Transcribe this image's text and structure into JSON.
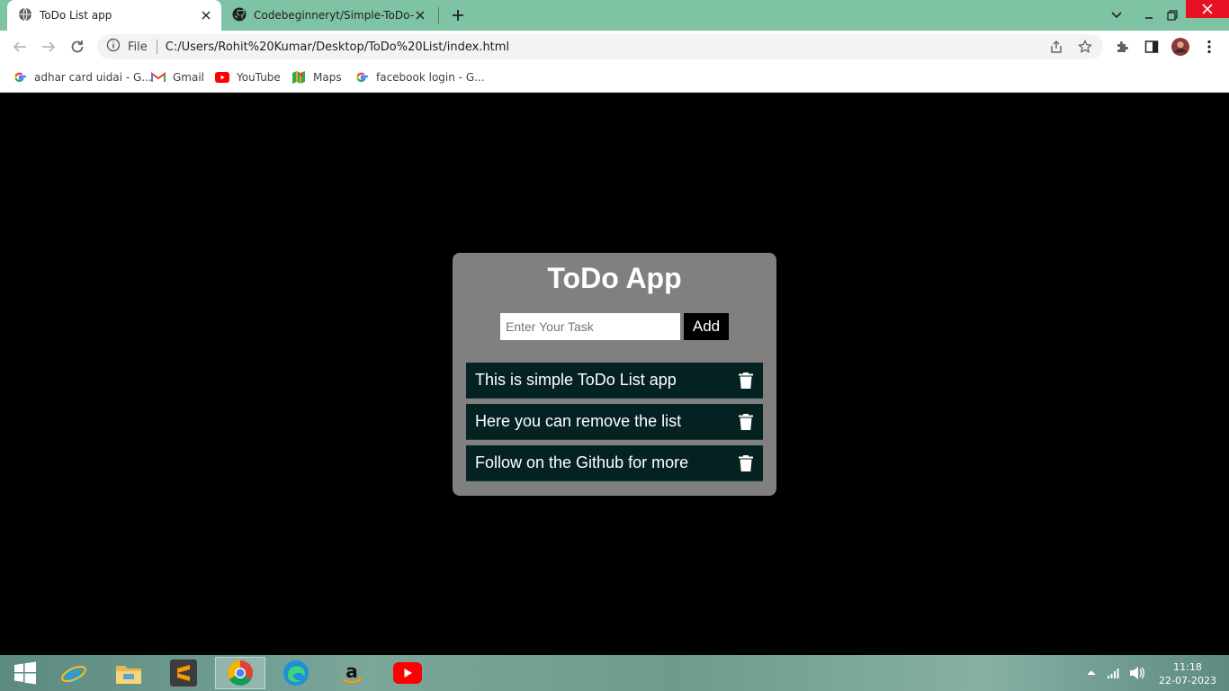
{
  "browser": {
    "tabs": [
      {
        "title": "ToDo List app",
        "active": true,
        "icon": "globe-icon"
      },
      {
        "title": "Codebeginneryt/Simple-ToDo-List",
        "active": false,
        "icon": "github-icon"
      }
    ],
    "address": {
      "scheme_label": "File",
      "url": "C:/Users/Rohit%20Kumar/Desktop/ToDo%20List/index.html"
    },
    "bookmarks": [
      {
        "label": "adhar card uidai - G...",
        "icon": "google-icon"
      },
      {
        "label": "Gmail",
        "icon": "gmail-icon"
      },
      {
        "label": "YouTube",
        "icon": "youtube-icon"
      },
      {
        "label": "Maps",
        "icon": "maps-icon"
      },
      {
        "label": "facebook login - G...",
        "icon": "google-icon"
      }
    ]
  },
  "app": {
    "title": "ToDo App",
    "input_placeholder": "Enter Your Task",
    "input_value": "",
    "add_label": "Add",
    "tasks": [
      {
        "text": "This is simple ToDo List app"
      },
      {
        "text": "Here you can remove the list"
      },
      {
        "text": "Follow on the Github for more"
      }
    ]
  },
  "taskbar": {
    "apps": [
      "start-icon",
      "internet-explorer-icon",
      "file-explorer-icon",
      "sublime-text-icon",
      "chrome-icon",
      "edge-icon",
      "amazon-icon",
      "youtube-icon"
    ],
    "time": "11:18",
    "date": "22-07-2023"
  },
  "colors": {
    "tabstrip": "#7fc3a5",
    "card": "#808080",
    "task_item": "#052222",
    "page_background": "#000000"
  }
}
